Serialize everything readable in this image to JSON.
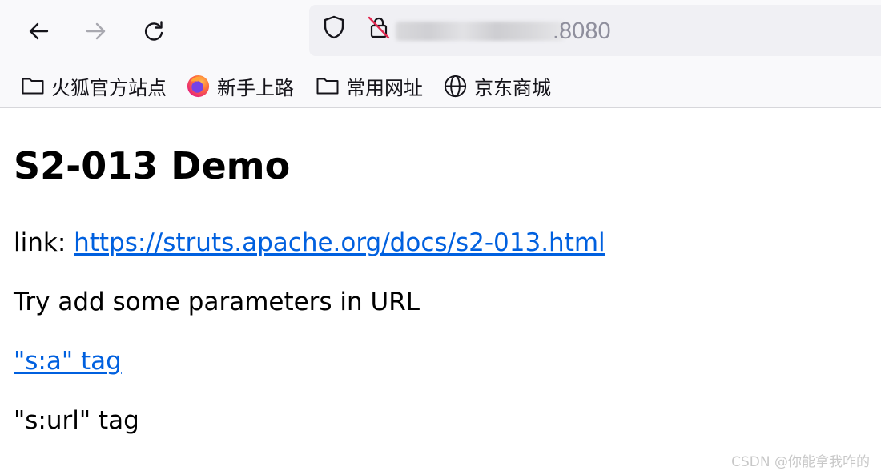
{
  "toolbar": {
    "back_icon": "arrow-left-icon",
    "forward_icon": "arrow-right-icon",
    "reload_icon": "reload-icon",
    "tracking_protection_icon": "shield-icon",
    "insecure_icon": "crossed-lock-icon",
    "url_suffix": ".8080"
  },
  "bookmarks": [
    {
      "label": "火狐官方站点",
      "icon": "folder-icon"
    },
    {
      "label": "新手上路",
      "icon": "firefox-logo-icon"
    },
    {
      "label": "常用网址",
      "icon": "folder-icon"
    },
    {
      "label": "京东商城",
      "icon": "globe-icon"
    }
  ],
  "page": {
    "heading": "S2-013 Demo",
    "link_prefix": "link: ",
    "link_url": "https://struts.apache.org/docs/s2-013.html",
    "instruction": "Try add some parameters in URL",
    "sa_tag_link": "\"s:a\" tag",
    "surl_tag": "\"s:url\" tag"
  },
  "watermark": "CSDN @你能拿我咋的",
  "colors": {
    "link": "#0060df",
    "chrome_bg": "#f9f9fb",
    "urlbar_bg": "#f0f0f4",
    "insecure_slash": "#e22850"
  }
}
